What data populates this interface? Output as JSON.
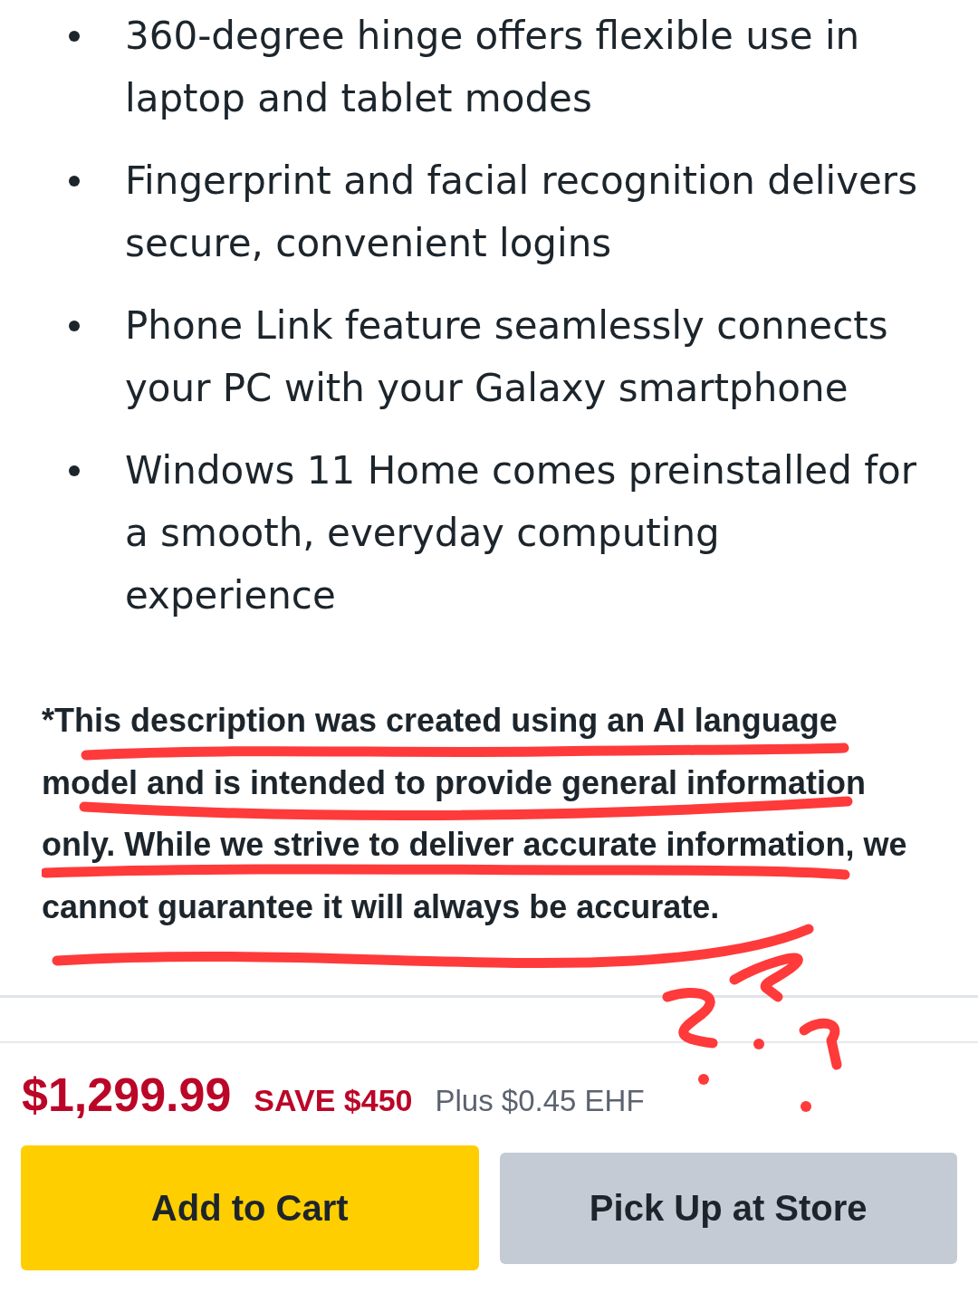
{
  "features": [
    "360-degree hinge offers flexible use in laptop and tablet modes",
    "Fingerprint and facial recognition delivers secure, convenient logins",
    "Phone Link feature seamlessly connects your PC with your Galaxy smartphone",
    "Windows 11 Home comes preinstalled for a smooth, everyday computing experience"
  ],
  "disclaimer": "*This description was created using an AI language model and is intended to provide general information only. While we strive to deliver accurate information, we cannot guarantee it will always be accurate.",
  "annotations": [
    {
      "kind": "underline"
    },
    {
      "kind": "underline"
    },
    {
      "kind": "underline"
    },
    {
      "kind": "underline"
    },
    {
      "kind": "question-mark"
    },
    {
      "kind": "question-mark"
    },
    {
      "kind": "question-mark"
    }
  ],
  "price": {
    "amount": "$1,299.99",
    "savings": "SAVE $450",
    "fee": "Plus $0.45 EHF"
  },
  "buttons": [
    {
      "label": "Add to Cart",
      "kind": "primary"
    },
    {
      "label": "Pick Up at Store",
      "kind": "secondary"
    }
  ]
}
